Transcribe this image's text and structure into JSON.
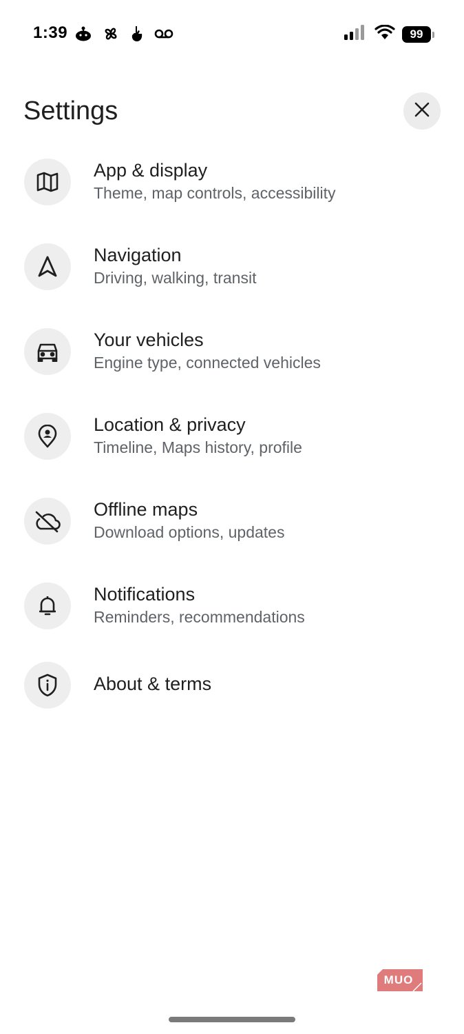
{
  "status_bar": {
    "time": "1:39",
    "battery": "99",
    "left_icons": [
      "reddit-icon",
      "pinwheel-icon",
      "hand-icon",
      "voicemail-icon"
    ],
    "right_icons": [
      "cellular-signal-icon",
      "wifi-icon",
      "battery-icon"
    ]
  },
  "header": {
    "title": "Settings",
    "close_icon": "close-icon"
  },
  "settings": {
    "items": [
      {
        "icon": "map-icon",
        "title": "App & display",
        "subtitle": "Theme, map controls, accessibility"
      },
      {
        "icon": "navigation-arrow-icon",
        "title": "Navigation",
        "subtitle": "Driving, walking, transit"
      },
      {
        "icon": "car-icon",
        "title": "Your vehicles",
        "subtitle": "Engine type, connected vehicles"
      },
      {
        "icon": "location-person-icon",
        "title": "Location & privacy",
        "subtitle": "Timeline, Maps history, profile"
      },
      {
        "icon": "cloud-off-icon",
        "title": "Offline maps",
        "subtitle": "Download options, updates"
      },
      {
        "icon": "bell-icon",
        "title": "Notifications",
        "subtitle": "Reminders, recommendations"
      },
      {
        "icon": "shield-info-icon",
        "title": "About & terms",
        "subtitle": ""
      }
    ]
  },
  "watermark": {
    "text": "MUO",
    "color": "#e07b7b"
  },
  "colors": {
    "icon_circle": "#eeeeee",
    "subtitle": "#5f6368",
    "title": "#1f1f1f"
  }
}
